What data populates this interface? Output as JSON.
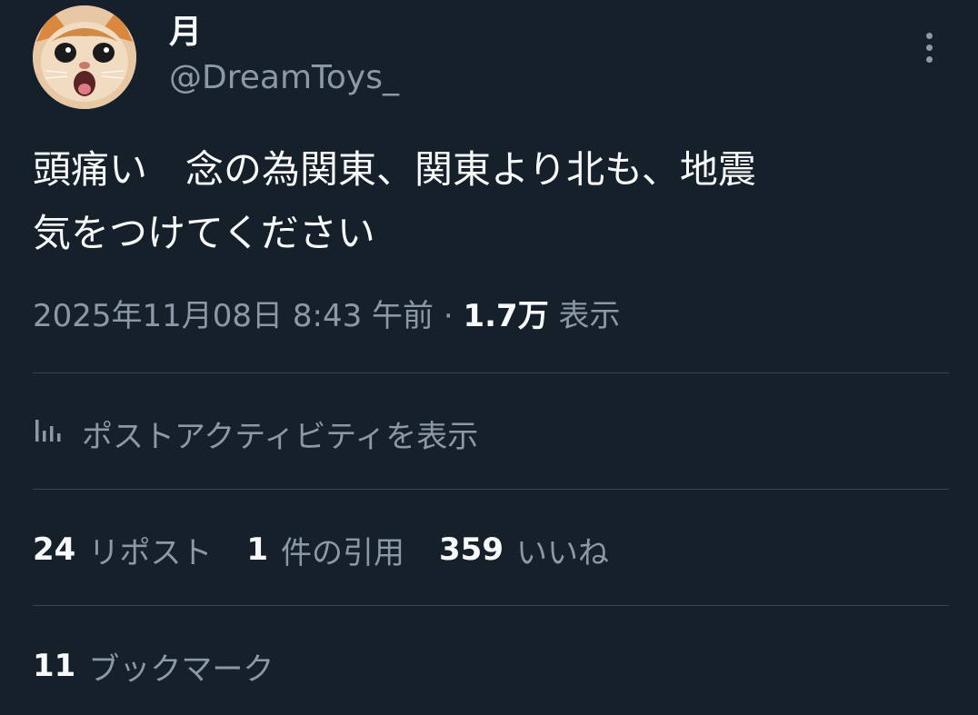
{
  "author": {
    "display_name": "月",
    "handle": "@DreamToys_",
    "avatar_icon": "cat-avatar"
  },
  "tweet": {
    "text": "頭痛い　念の為関東、関東より北も、地震\n気をつけてください"
  },
  "meta": {
    "timestamp": "2025年11月08日 8:43 午前",
    "separator": " · ",
    "views_count": "1.7万",
    "views_label": " 表示"
  },
  "activity": {
    "icon": "bar-chart-icon",
    "label": "ポストアクティビティを表示"
  },
  "stats": {
    "reposts": {
      "count": "24",
      "label": "リポスト"
    },
    "quotes": {
      "count": "1",
      "label": "件の引用"
    },
    "likes": {
      "count": "359",
      "label": "いいね"
    },
    "bookmarks": {
      "count": "11",
      "label": "ブックマーク"
    }
  },
  "colors": {
    "background": "#15202b",
    "text_primary": "#f7f9f9",
    "text_secondary": "#8b98a5",
    "divider": "#38444d"
  }
}
